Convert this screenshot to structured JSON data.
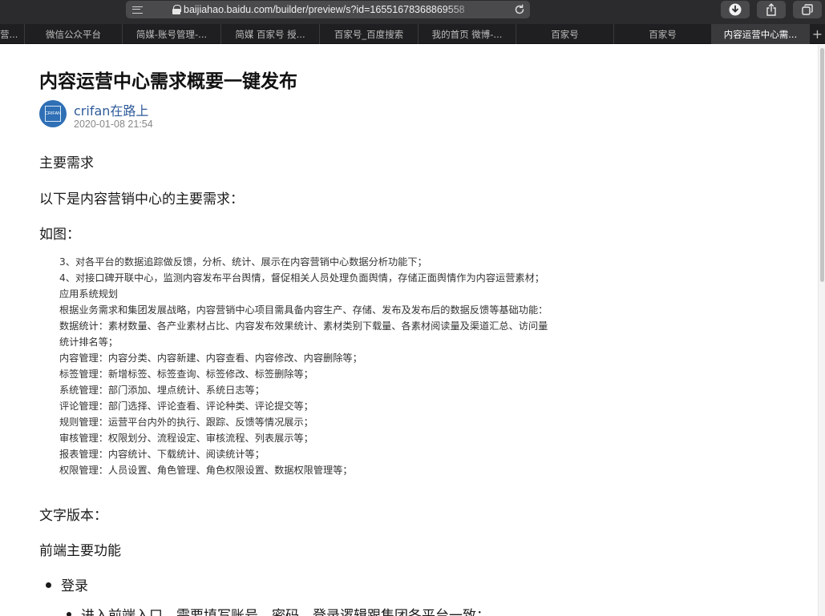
{
  "browser": {
    "url": "baijiahao.baidu.com/builder/preview/s?id=16551678368869558",
    "tabs": [
      {
        "label": "营..."
      },
      {
        "label": "微信公众平台"
      },
      {
        "label": "简媒-账号管理-..."
      },
      {
        "label": "简媒 百家号 授..."
      },
      {
        "label": "百家号_百度搜索"
      },
      {
        "label": "我的首页 微博-..."
      },
      {
        "label": "百家号"
      },
      {
        "label": "百家号"
      },
      {
        "label": "内容运营中心需..."
      }
    ],
    "new_tab": "+"
  },
  "article": {
    "title": "内容运营中心需求概要一键发布",
    "author": {
      "name": "crifan在路上",
      "avatar_text": "CRIFAN",
      "date": "2020-01-08  21:54"
    },
    "section_main": "主要需求",
    "intro": "以下是内容营销中心的主要需求：",
    "figure_label": "如图：",
    "figure_lines": [
      "3、对各平台的数据追踪做反馈，分析、统计、展示在内容营销中心数据分析功能下；",
      "4、对接口碑开联中心，监测内容发布平台舆情，督促相关人员处理负面舆情，存储正面舆情作为内容运营素材；",
      "应用系统规划",
      "根据业务需求和集团发展战略，内容营销中心项目需具备内容生产、存储、发布及发布后的数据反馈等基础功能：",
      "数据统计：素材数量、各产业素材占比、内容发布效果统计、素材类别下载量、各素材阅读量及渠道汇总、访问量",
      "统计排名等；",
      "内容管理：内容分类、内容新建、内容查看、内容修改、内容删除等；",
      "标签管理：新增标签、标签查询、标签修改、标签删除等；",
      "系统管理：部门添加、埋点统计、系统日志等；",
      "评论管理：部门选择、评论查看、评论种类、评论提交等；",
      "规则管理：运营平台内外的执行、跟踪、反馈等情况展示；",
      "审核管理：权限划分、流程设定、审核流程、列表展示等；",
      "报表管理：内容统计、下载统计、阅读统计等；",
      "权限管理：人员设置、角色管理、角色权限设置、数据权限管理等；"
    ],
    "text_version": "文字版本：",
    "frontend_heading": "前端主要功能",
    "bullet_login": "登录",
    "bullet_login_sub": "进入前端入口，需要填写账号、密码，登录逻辑跟集团各平台一致；"
  },
  "colors": {
    "toolbar_bg": "#2b2b2d",
    "tabbar_bg": "#1f1f21",
    "active_tab_bg": "#3a3a3c",
    "author_link": "#2e5b9a",
    "avatar_bg": "#2e6fb5"
  }
}
